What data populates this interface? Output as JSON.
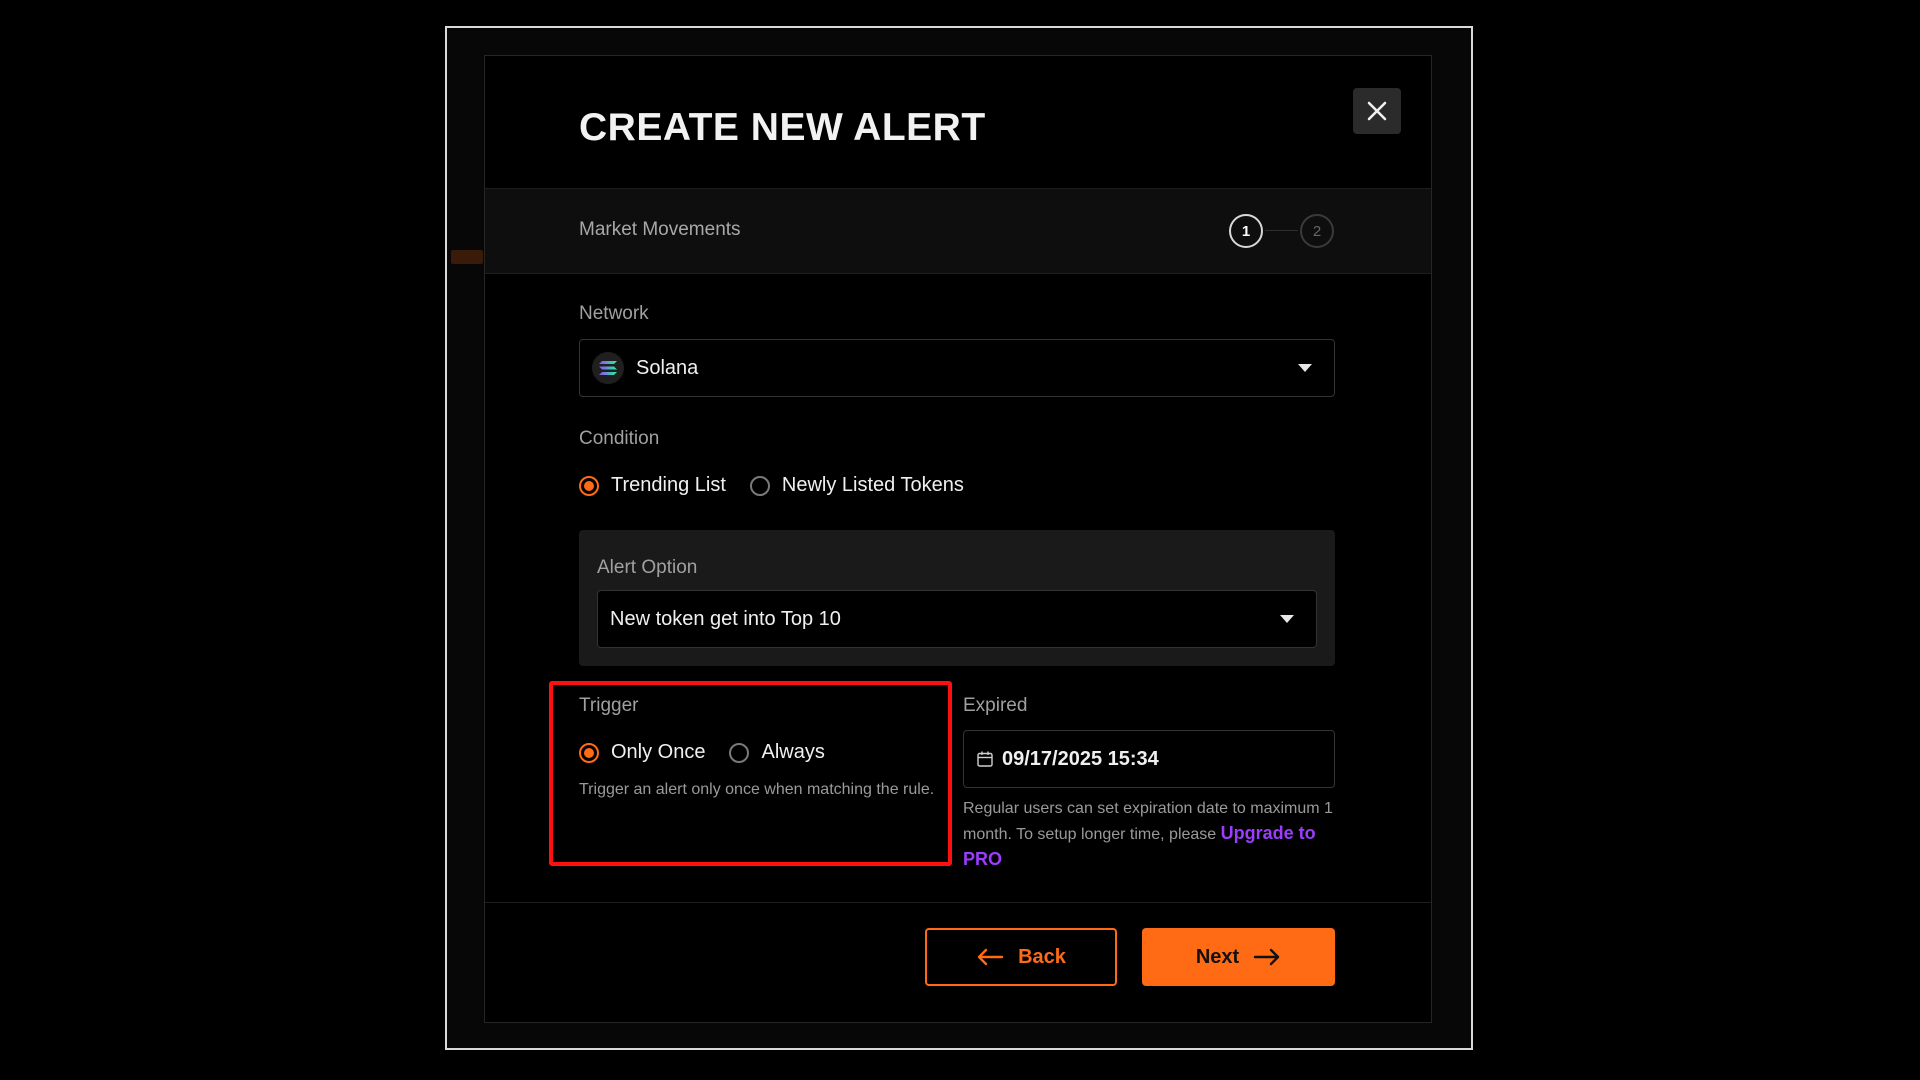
{
  "modal": {
    "title": "CREATE NEW ALERT",
    "steps_label": "Market Movements",
    "steps": [
      "1",
      "2"
    ],
    "current_step": 1
  },
  "network": {
    "label": "Network",
    "value": "Solana",
    "icon": "solana-logo-icon"
  },
  "condition": {
    "label": "Condition",
    "options": [
      "Trending List",
      "Newly Listed Tokens"
    ],
    "selected": "Trending List"
  },
  "alert_option": {
    "label": "Alert Option",
    "value": "New token get into Top 10"
  },
  "trigger": {
    "label": "Trigger",
    "options": [
      "Only Once",
      "Always"
    ],
    "selected": "Only Once",
    "helper": "Trigger an alert only once when matching the rule."
  },
  "expired": {
    "label": "Expired",
    "value": "09/17/2025 15:34",
    "helper": "Regular users can set expiration date to maximum 1 month. To setup longer time, please",
    "link": "Upgrade to PRO"
  },
  "footer": {
    "back_label": "Back",
    "next_label": "Next"
  },
  "colors": {
    "accent": "#ff6a14",
    "link": "#9b3cff",
    "highlight": "#ff1010"
  }
}
